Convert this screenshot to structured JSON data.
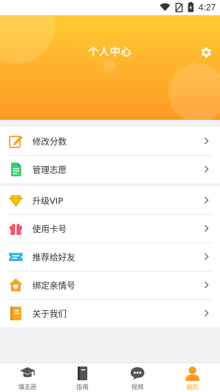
{
  "status_bar": {
    "time": "4:27"
  },
  "header": {
    "title": "个人中心",
    "icon": "gear-icon"
  },
  "menu_group_1": [
    {
      "label": "修改分数",
      "icon": "pencil-note-icon",
      "color": "#f6a623"
    },
    {
      "label": "管理志愿",
      "icon": "document-icon",
      "color": "#3ccf7a"
    }
  ],
  "menu_group_2": [
    {
      "label": "升级VIP",
      "icon": "diamond-icon",
      "color": "#f5c518"
    },
    {
      "label": "使用卡号",
      "icon": "gift-icon",
      "color": "#f05a6e"
    },
    {
      "label": "推荐给好友",
      "icon": "ticket-icon",
      "color": "#34b4f0"
    },
    {
      "label": "绑定亲情号",
      "icon": "home-heart-icon",
      "color": "#f6a623"
    },
    {
      "label": "关于我们",
      "icon": "book-icon",
      "color": "#f6a623"
    }
  ],
  "tabs": [
    {
      "label": "填志愿",
      "icon": "graduation-cap-icon",
      "active": false
    },
    {
      "label": "指南",
      "icon": "book-icon",
      "active": false
    },
    {
      "label": "视频",
      "icon": "chat-bubble-icon",
      "active": false
    },
    {
      "label": "我的",
      "icon": "person-icon",
      "active": true
    }
  ],
  "colors": {
    "accent": "#ff9a22",
    "header_top": "#ffcc33",
    "header_bottom": "#ff9a22"
  }
}
